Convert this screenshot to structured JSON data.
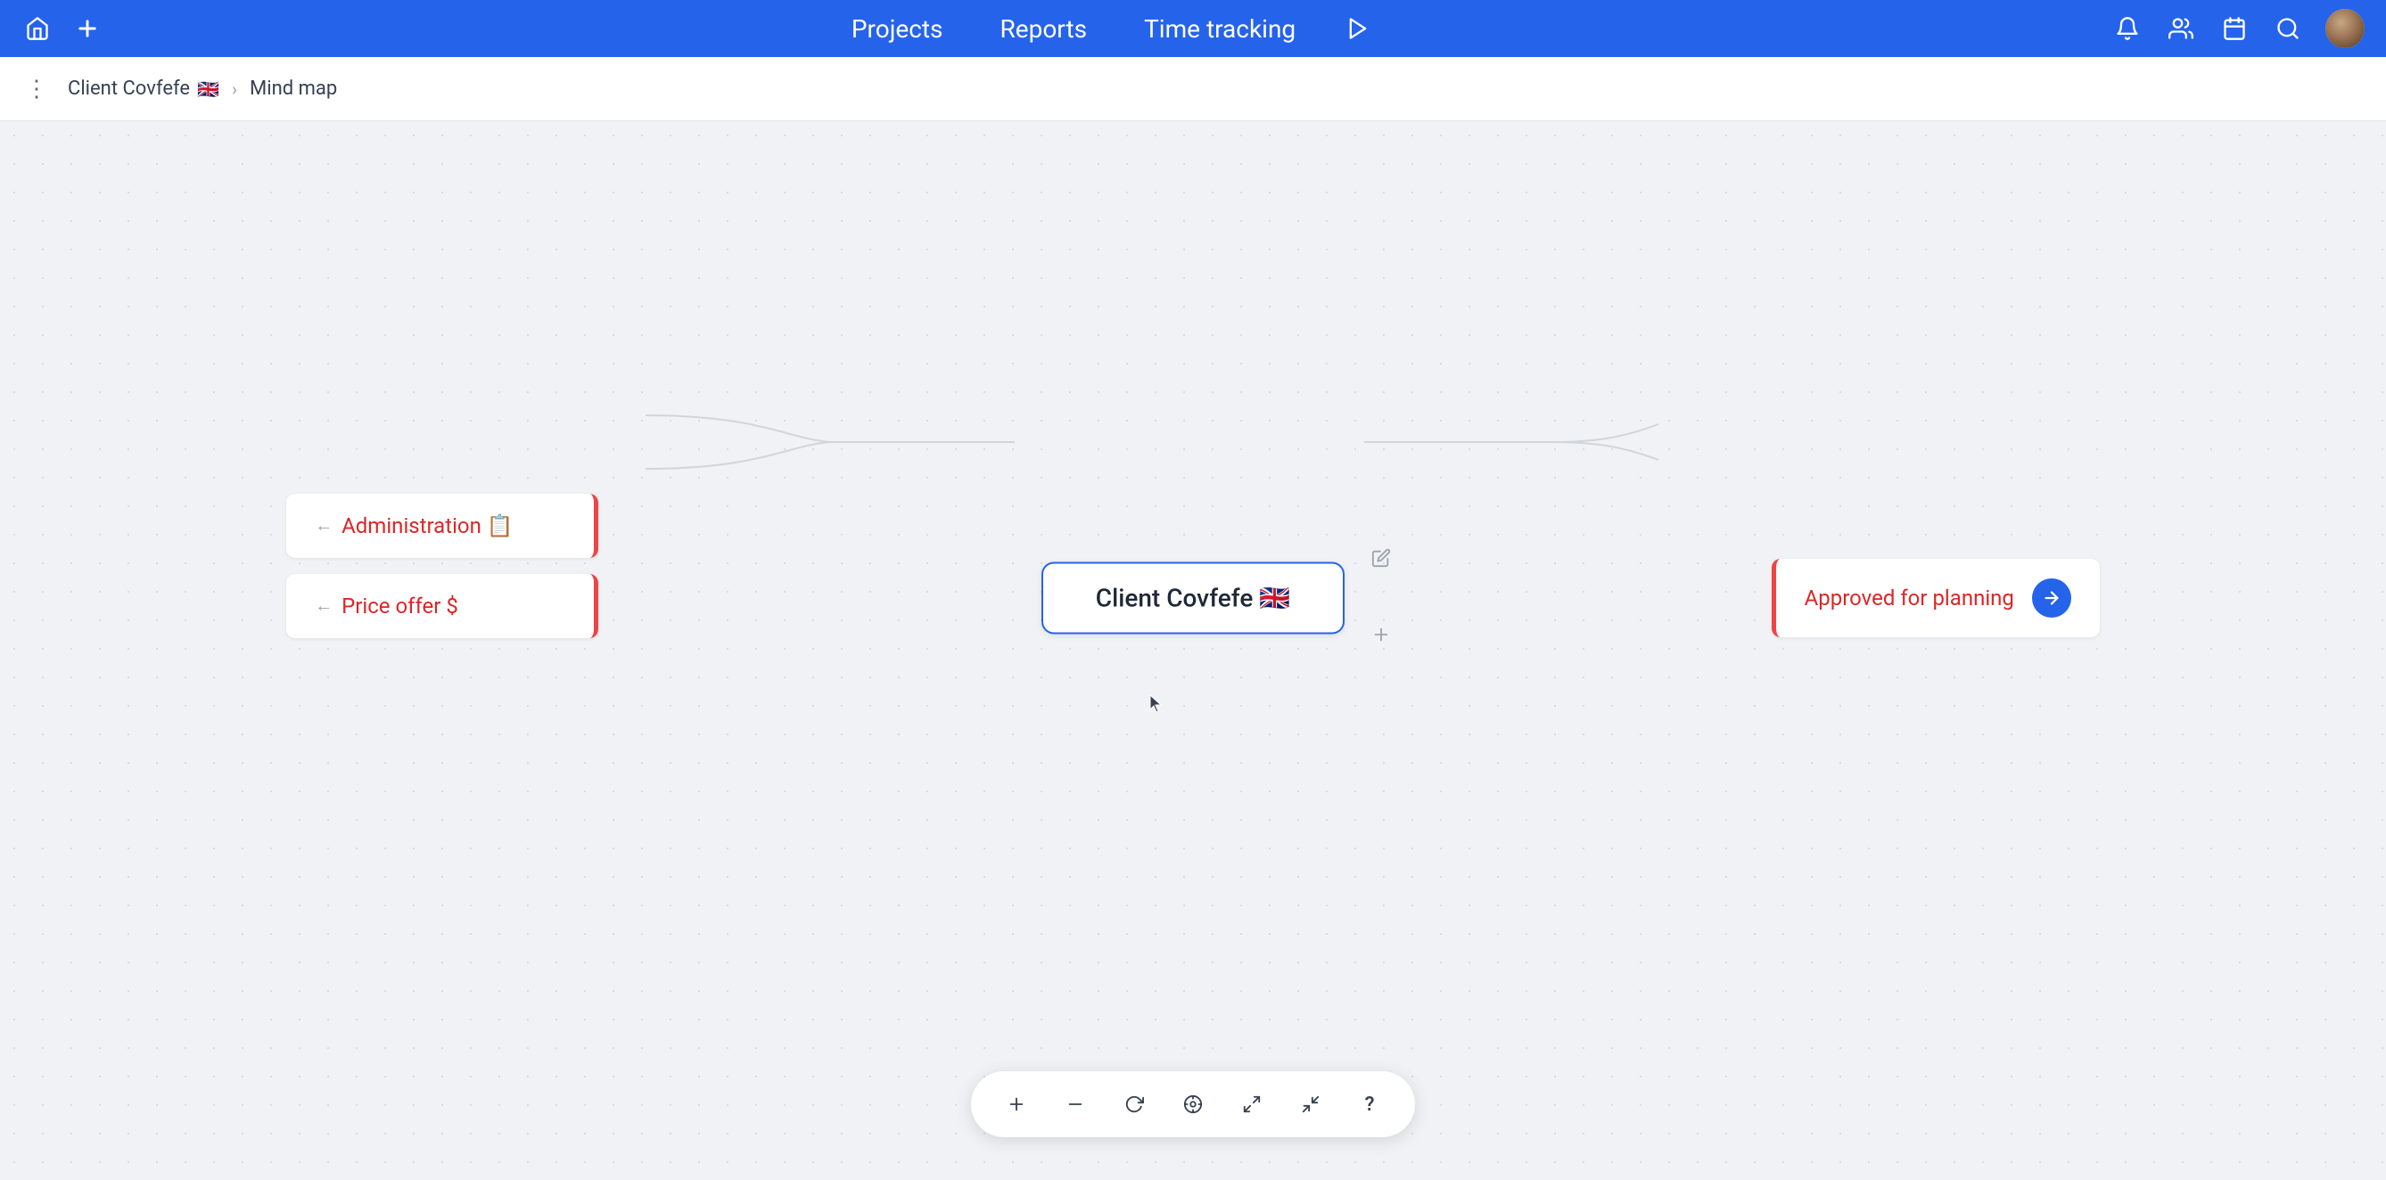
{
  "header": {
    "nav": {
      "projects_label": "Projects",
      "reports_label": "Reports",
      "time_tracking_label": "Time tracking"
    },
    "icons": {
      "home": "⌂",
      "add": "+",
      "bell": "🔔",
      "users": "👥",
      "calendar": "📅",
      "search": "🔍",
      "play": "▷"
    }
  },
  "breadcrumb": {
    "project_name": "Client Covfefe",
    "flag": "🇬🇧",
    "separator": "›",
    "current_page": "Mind map",
    "dots_icon": "⋮"
  },
  "mindmap": {
    "central_node": {
      "label": "Client Covfefe 🇬🇧"
    },
    "left_nodes": [
      {
        "label": "Administration 📋",
        "arrow": "←"
      },
      {
        "label": "Price offer $",
        "arrow": "←"
      }
    ],
    "right_nodes": [
      {
        "label": "Approved for planning",
        "arrow_icon": "→"
      }
    ]
  },
  "toolbar": {
    "zoom_in": "+",
    "zoom_out": "−",
    "refresh": "↺",
    "target": "◎",
    "fit_width": "⇔",
    "expand": "⤢",
    "help": "?"
  },
  "colors": {
    "header_bg": "#2563eb",
    "accent_blue": "#2563eb",
    "node_red": "#dc2626",
    "border_red": "#ef4444",
    "central_border": "#2563eb",
    "bg": "#f0f2f5"
  }
}
